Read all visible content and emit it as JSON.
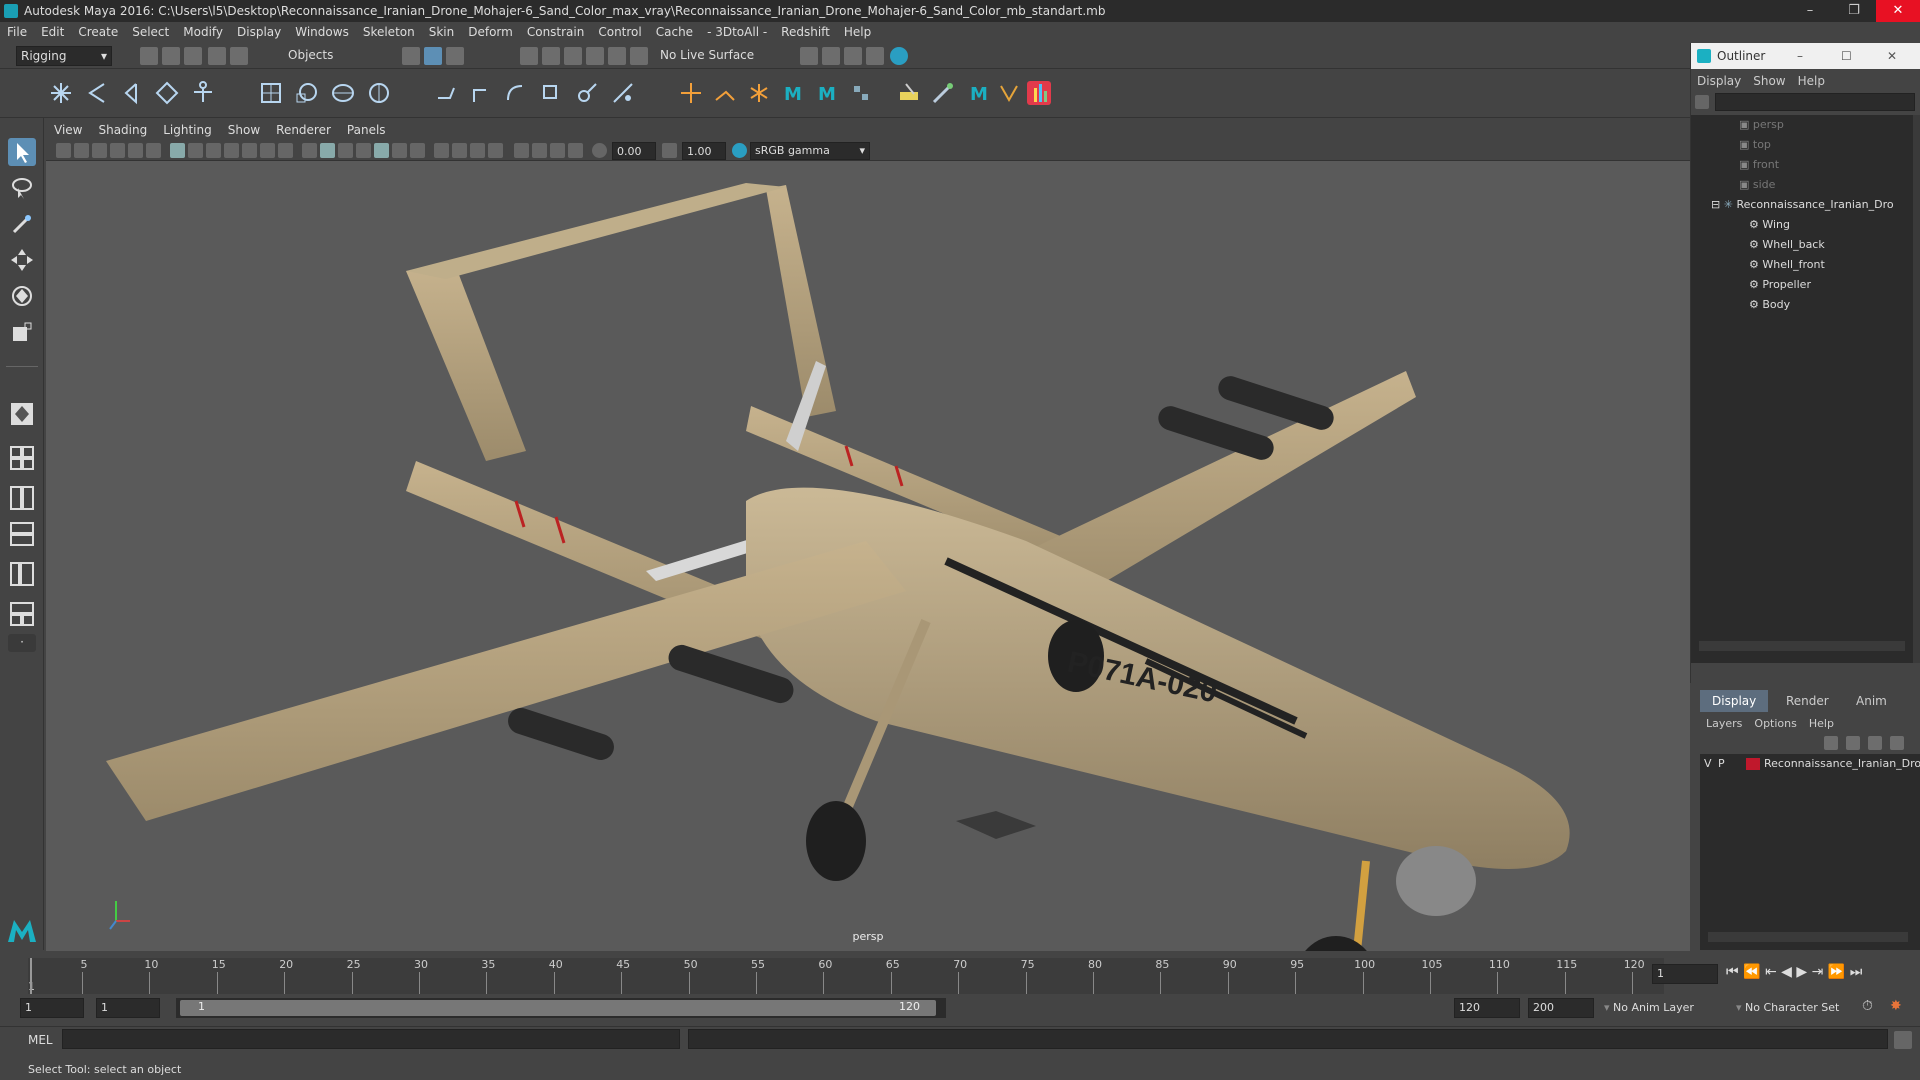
{
  "title": "Autodesk Maya 2016: C:\\Users\\l5\\Desktop\\Reconnaissance_Iranian_Drone_Mohajer-6_Sand_Color_max_vray\\Reconnaissance_Iranian_Drone_Mohajer-6_Sand_Color_mb_standart.mb",
  "window_controls": {
    "minimize": "–",
    "restore": "❐",
    "close": "✕"
  },
  "menus": [
    "File",
    "Edit",
    "Create",
    "Select",
    "Modify",
    "Display",
    "Windows",
    "Skeleton",
    "Skin",
    "Deform",
    "Constrain",
    "Control",
    "Cache",
    "- 3DtoAll -",
    "Redshift",
    "Help"
  ],
  "statusline": {
    "menuset": "Rigging",
    "selection_mode": "Objects",
    "live_surface": "No Live Surface"
  },
  "viewport": {
    "menus": [
      "View",
      "Shading",
      "Lighting",
      "Show",
      "Renderer",
      "Panels"
    ],
    "exposure": "0.00",
    "gamma": "1.00",
    "color_space": "sRGB gamma",
    "camera": "persp",
    "drone_marking": "P071A-020"
  },
  "outliner": {
    "title": "Outliner",
    "menus": [
      "Display",
      "Show",
      "Help"
    ],
    "cameras": [
      "persp",
      "top",
      "front",
      "side"
    ],
    "root": "Reconnaissance_Iranian_Dro",
    "children": [
      "Wing",
      "Whell_back",
      "Whell_front",
      "Propeller",
      "Body"
    ]
  },
  "layers": {
    "tabs": [
      "Display",
      "Render",
      "Anim"
    ],
    "menus": [
      "Layers",
      "Options",
      "Help"
    ],
    "layer_v": "V",
    "layer_p": "P",
    "layer_name": "Reconnaissance_Iranian_Dro",
    "layer_color": "#c0182c"
  },
  "timeline": {
    "ticks": [
      "5",
      "10",
      "15",
      "20",
      "25",
      "30",
      "35",
      "40",
      "45",
      "50",
      "55",
      "60",
      "65",
      "70",
      "75",
      "80",
      "85",
      "90",
      "95",
      "100",
      "105",
      "110",
      "115",
      "120"
    ],
    "first_label": "1",
    "current_frame": "1"
  },
  "range": {
    "start": "1",
    "playback_start": "1",
    "slider_start": "1",
    "slider_end": "120",
    "playback_end": "120",
    "end": "200",
    "anim_layer": "No Anim Layer",
    "character_set": "No Character Set"
  },
  "cmdline": {
    "label": "MEL"
  },
  "help_text": "Select Tool: select an object"
}
